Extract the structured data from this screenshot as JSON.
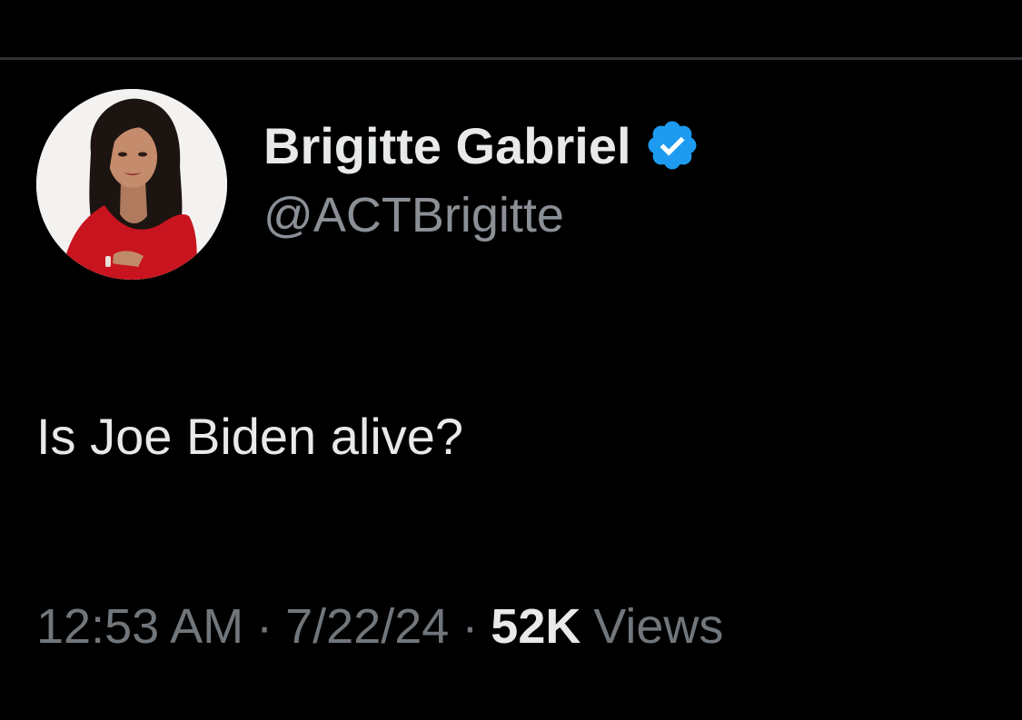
{
  "tweet": {
    "author": {
      "display_name": "Brigitte Gabriel",
      "handle": "@ACTBrigitte",
      "verified": true,
      "verified_badge_color": "#1d9bf0"
    },
    "text": "Is Joe Biden alive?",
    "meta": {
      "time": "12:53 AM",
      "separator": "·",
      "date": "7/22/24",
      "views_count": "52K",
      "views_label": "Views"
    }
  },
  "colors": {
    "background": "#000000",
    "primary_text": "#e7e9ea",
    "secondary_text": "#71767b",
    "divider": "#2f3336"
  }
}
